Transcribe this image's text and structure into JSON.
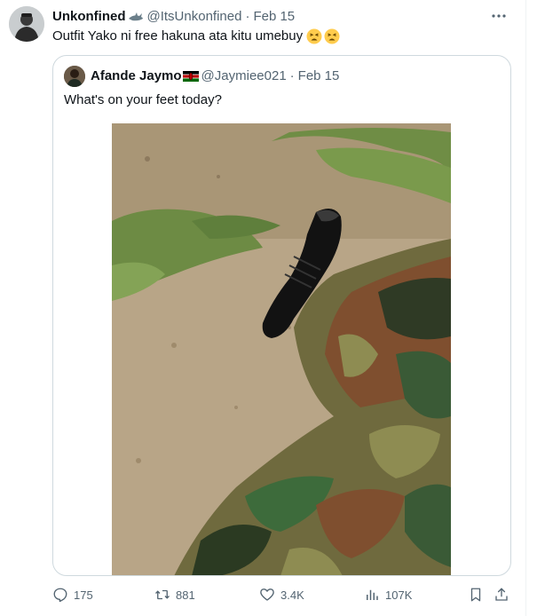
{
  "tweet": {
    "author_name": "Unkonfined",
    "author_handle": "@ItsUnkonfined",
    "date": "Feb 15",
    "text": "Outfit Yako ni free  hakuna ata kitu umebuy",
    "emoji": [
      "tired-face",
      "tired-face"
    ]
  },
  "quoted": {
    "author_name": "Afande Jaymo",
    "author_badge": "kenya-flag",
    "author_handle": "@Jaymiee021",
    "date": "Feb 15",
    "text": "What's on your feet today?",
    "image": "black-boot-camouflage-trousers"
  },
  "actions": {
    "replies": "175",
    "reposts": "881",
    "likes": "3.4K",
    "views": "107K"
  },
  "colors": {
    "text": "#0f1419",
    "muted": "#536471",
    "border": "#cfd9de"
  }
}
